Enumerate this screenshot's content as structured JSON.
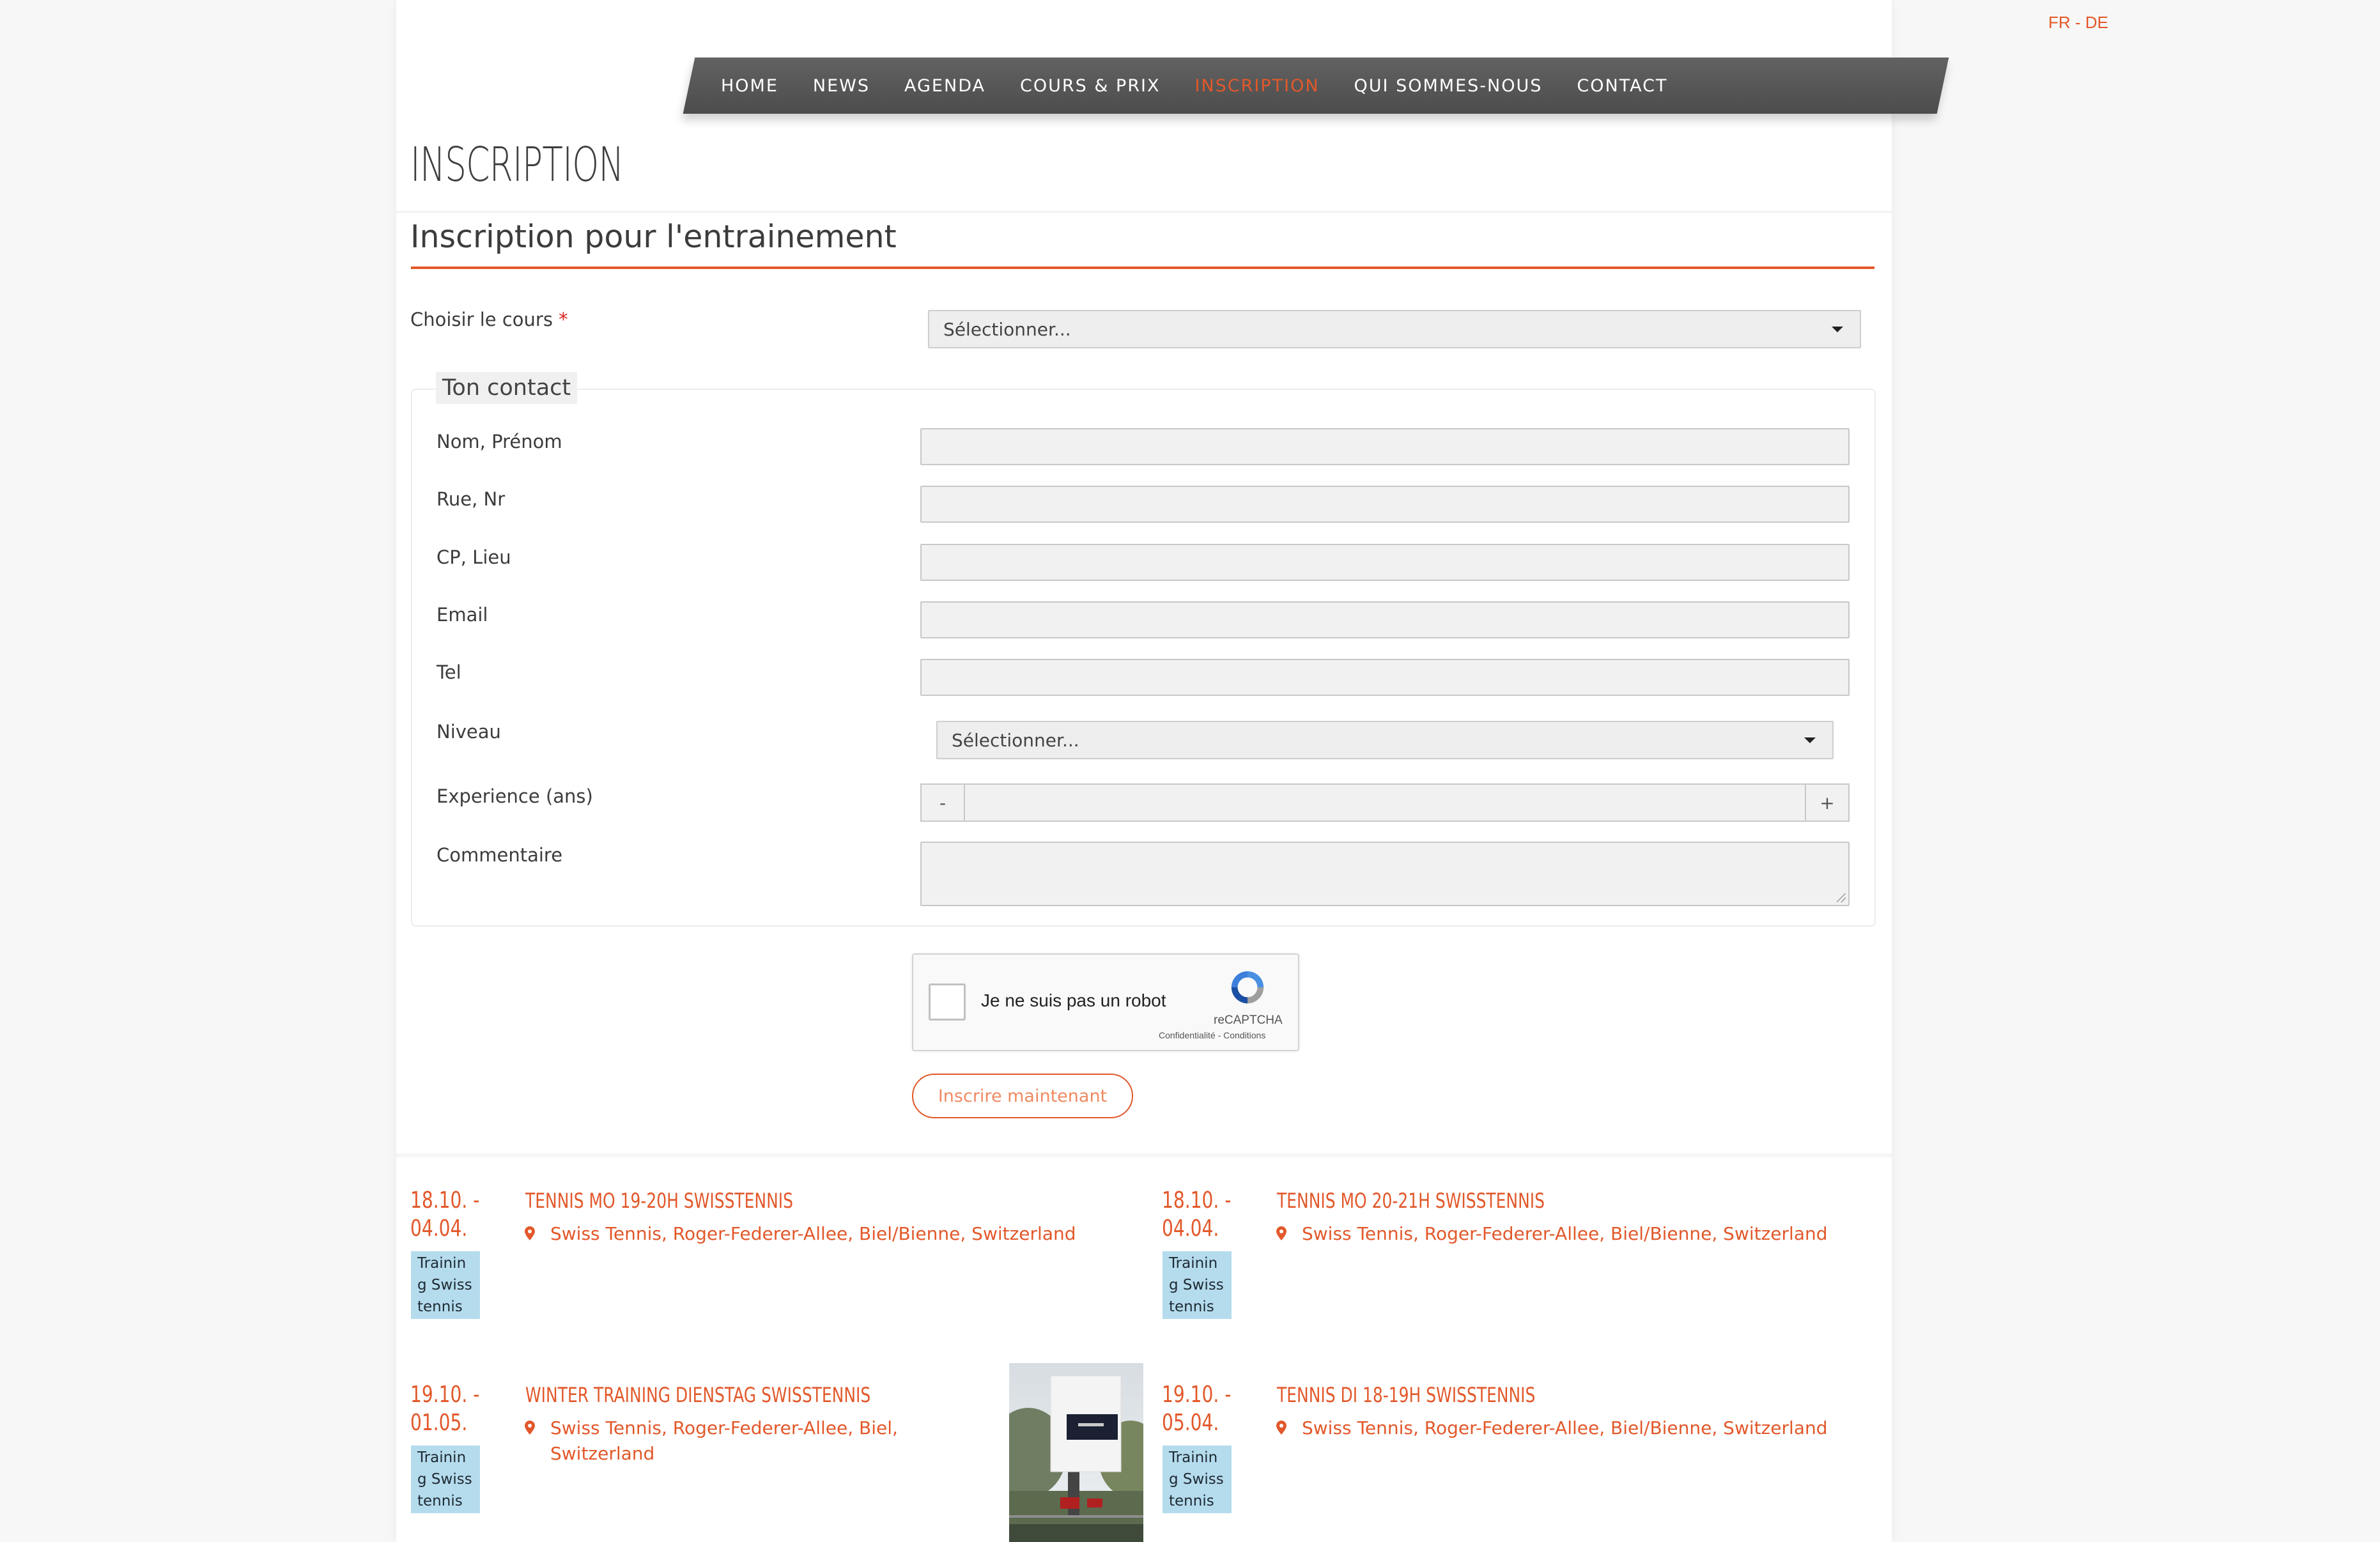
{
  "language": {
    "fr": "FR",
    "separator": " - ",
    "de": "DE"
  },
  "nav": {
    "items": [
      {
        "label": "HOME"
      },
      {
        "label": "NEWS"
      },
      {
        "label": "AGENDA"
      },
      {
        "label": "COURS & PRIX"
      },
      {
        "label": "INSCRIPTION"
      },
      {
        "label": "QUI SOMMES-NOUS"
      },
      {
        "label": "CONTACT"
      }
    ],
    "active": "INSCRIPTION"
  },
  "page": {
    "title": "INSCRIPTION"
  },
  "form": {
    "title": "Inscription pour l'entrainement",
    "course": {
      "label": "Choisir le cours",
      "required_mark": "*",
      "value": "Sélectionner..."
    },
    "contact": {
      "legend": "Ton contact",
      "fields": {
        "name": {
          "label": "Nom, Prénom",
          "value": ""
        },
        "street": {
          "label": "Rue, Nr",
          "value": ""
        },
        "city": {
          "label": "CP, Lieu",
          "value": ""
        },
        "email": {
          "label": "Email",
          "value": ""
        },
        "tel": {
          "label": "Tel",
          "value": ""
        },
        "level": {
          "label": "Niveau",
          "value": "Sélectionner..."
        },
        "experience": {
          "label": "Experience (ans)",
          "minus": "-",
          "plus": "+",
          "value": ""
        },
        "comment": {
          "label": "Commentaire",
          "value": ""
        }
      }
    },
    "captcha": {
      "text": "Je ne suis pas un robot",
      "brand": "reCAPTCHA",
      "links": "Confidentialité - Conditions"
    },
    "submit_label": "Inscrire maintenant"
  },
  "events": [
    {
      "date": "18.10. - 04.04.",
      "tag": "Training Swisstennis",
      "title": "TENNIS MO 19-20H SWISSTENNIS",
      "location": "Swiss Tennis, Roger-Federer-Allee, Biel/Bienne, Switzerland"
    },
    {
      "date": "18.10. - 04.04.",
      "tag": "Training Swisstennis",
      "title": "TENNIS MO 20-21H SWISSTENNIS",
      "location": "Swiss Tennis, Roger-Federer-Allee, Biel/Bienne, Switzerland"
    },
    {
      "date": "19.10. - 01.05.",
      "tag": "Training Swisstennis",
      "title": "WINTER TRAINING DIENSTAG SWISSTENNIS",
      "location": "Swiss Tennis, Roger-Federer-Allee, Biel, Switzerland"
    },
    {
      "date": "19.10. - 05.04.",
      "tag": "Training Swisstennis",
      "title": "TENNIS DI 18-19H SWISSTENNIS",
      "location": "Swiss Tennis, Roger-Federer-Allee, Biel/Bienne, Switzerland"
    }
  ],
  "colors": {
    "accent": "#e2582a",
    "nav_bg": "#555555",
    "tag_bg": "#b5dced"
  }
}
